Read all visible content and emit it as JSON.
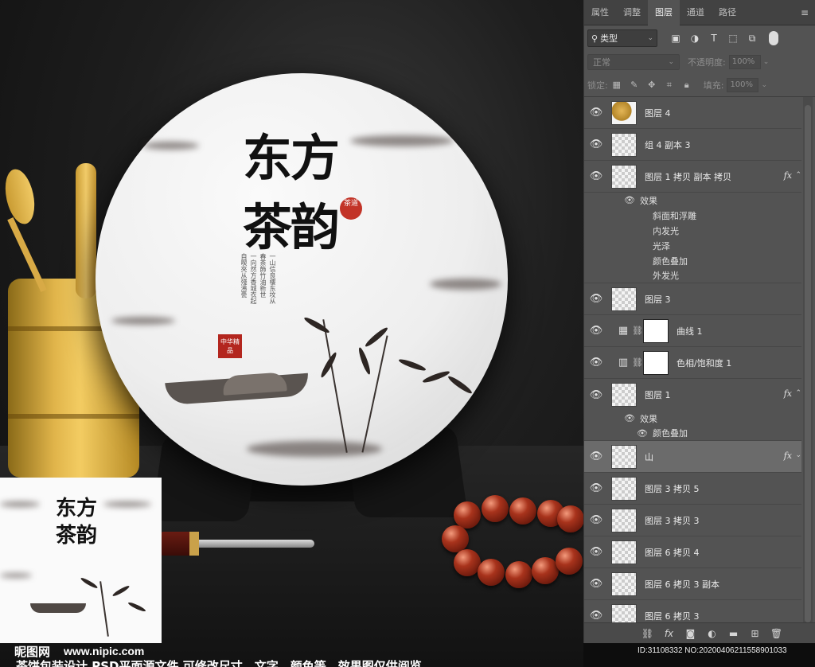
{
  "canvas": {
    "title_top": "东方",
    "title_bottom": "茶韵",
    "seal_small": "茶道",
    "seal_red": "中华精品",
    "poem_columns": [
      "一山信良樓东坟从",
      "春茶飾竹油新世",
      "一向然方香城衣起",
      "自喫夾从殘沸甍"
    ]
  },
  "thumbnail": {
    "title_top": "东方",
    "title_bottom": "茶韵"
  },
  "watermark": {
    "logo": "昵图网",
    "url": "www.nipic.com",
    "caption": "茶饼包装设计 PSD平面源文件 可修改尺寸、文字、颜色等。效果图仅供阅览"
  },
  "id_bar": {
    "text": "ID:31108332 NO:20200406211558901033"
  },
  "panel": {
    "tabs": [
      {
        "label": "属性"
      },
      {
        "label": "调整"
      },
      {
        "label": "图层"
      },
      {
        "label": "通道"
      },
      {
        "label": "路径"
      }
    ],
    "filter": {
      "kind_label": "类型"
    },
    "blend": {
      "mode": "正常",
      "opacity_label": "不透明度:",
      "opacity_value": "100%"
    },
    "lock": {
      "label": "锁定:",
      "fill_label": "填充:",
      "fill_value": "100%"
    },
    "layers": [
      {
        "name": "图层 4"
      },
      {
        "name": "组 4 副本 3"
      },
      {
        "name": "图层 1 拷贝 副本 拷贝"
      },
      {
        "name": "图层 3"
      },
      {
        "name": "曲线 1"
      },
      {
        "name": "色相/饱和度 1"
      },
      {
        "name": "图层 1"
      },
      {
        "name": "山"
      },
      {
        "name": "图层 3 拷贝 5"
      },
      {
        "name": "图层 3 拷贝 3"
      },
      {
        "name": "图层 6 拷贝 4"
      },
      {
        "name": "图层 6 拷贝 3 副本"
      },
      {
        "name": "图层 6 拷贝 3"
      }
    ],
    "effects_label": "效果",
    "effects_group1": [
      "斜面和浮雕",
      "内发光",
      "光泽",
      "颜色叠加",
      "外发光"
    ],
    "effects_group2": [
      "颜色叠加"
    ],
    "fx_label": "fx"
  }
}
